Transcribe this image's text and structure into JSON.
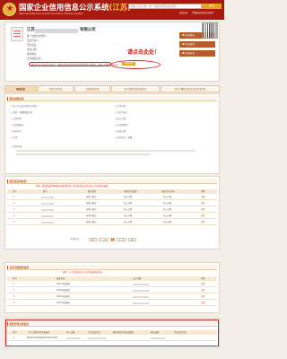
{
  "header": {
    "title_main": "国家企业信用信息公示系统",
    "title_region": "(江苏)",
    "subtitle": "National Enterprise Credit Information Publicity System",
    "search_placeholder": "请输入企业名称、统一社会信用代码或注册号",
    "search_button": "搜 索",
    "links": [
      "信息公告",
      "严重违法失信企业名单"
    ]
  },
  "company": {
    "name_prefix": "江苏",
    "name_suffix": "有限公司",
    "status_badge": "存续",
    "info_lines": [
      "统一社会信用代码：",
      "法定代表人：",
      "登记机关：",
      "成立日期：",
      "通讯地址：",
      "企业联系方式："
    ],
    "alert_text": "◆ 该企业于某年某月某日，因通过登记的住所或者经营场所无法联系，被列入经营异常名录",
    "detail_button": "查看详情",
    "callout": "请点击此处！",
    "side_buttons": [
      "发送报告",
      "信息打印",
      "信息补录"
    ]
  },
  "tabs": [
    "基础信息",
    "行政许可信息",
    "行政处罚信息",
    "列入经营异常名录信息",
    "列入严重违法失信企业名单信息"
  ],
  "basic_info": {
    "section_title": "营业执照信息",
    "fields_left": [
      {
        "k": "统一社会信用代码/注册号：",
        "v": ""
      },
      {
        "k": "类型：",
        "v": "有限责任公司"
      },
      {
        "k": "注册资本：",
        "v": ""
      },
      {
        "k": "营业期限自：",
        "v": ""
      },
      {
        "k": "登记机关：",
        "v": ""
      },
      {
        "k": "住所：",
        "v": ""
      }
    ],
    "fields_right": [
      {
        "k": "企业名称：",
        "v": ""
      },
      {
        "k": "法定代表人：",
        "v": ""
      },
      {
        "k": "成立日期：",
        "v": ""
      },
      {
        "k": "营业期限至：",
        "v": ""
      },
      {
        "k": "核准日期：",
        "v": ""
      },
      {
        "k": "登记状态：",
        "v": "存续"
      }
    ],
    "scope_label": "经营范围："
  },
  "shareholders": {
    "section_title": "股东及出资信息",
    "note": "说明：请企业及时更新股东及出资信息，登记机关依法对企业公示信息进行抽查。",
    "columns": [
      "序号",
      "股东",
      "股东类型",
      "证照/证件类型",
      "证照/证件号码",
      "详情"
    ],
    "rows": [
      {
        "no": "1",
        "type": "自然人股东",
        "id_type": "非公示项",
        "detail": "查看"
      },
      {
        "no": "2",
        "type": "自然人股东",
        "id_type": "非公示项",
        "detail": "查看"
      },
      {
        "no": "3",
        "type": "自然人股东",
        "id_type": "非公示项",
        "detail": "查看"
      },
      {
        "no": "4",
        "type": "自然人股东",
        "id_type": "非公示项",
        "detail": "查看"
      },
      {
        "no": "5",
        "type": "自然人股东",
        "id_type": "非公示项",
        "detail": "查看"
      }
    ],
    "pager": {
      "total": "共5条信息",
      "first": "首页",
      "prev": "上一页",
      "page": "1",
      "next": "下一页",
      "last": "末页"
    }
  },
  "annual_reports": {
    "section_title": "企业年度报告信息",
    "note": "说明：以下为企业自行公示的年度报告信息。",
    "columns": [
      "序号",
      "报送年度",
      "公示日期",
      "详情"
    ],
    "rows": [
      {
        "no": "1",
        "year": "2017年度报告",
        "date": "",
        "detail": "查看"
      },
      {
        "no": "2",
        "year": "2016年度报告",
        "date": "",
        "detail": "查看"
      },
      {
        "no": "3",
        "year": "2015年度报告",
        "date": "",
        "detail": "查看"
      },
      {
        "no": "4",
        "year": "2014年度报告",
        "date": "",
        "detail": "查看"
      }
    ]
  },
  "abnormal_list": {
    "section_title": "经营异常名录信息",
    "columns": [
      "序号",
      "列入经营异常名录原因",
      "列入日期",
      "作出决定机关",
      "移出经营异常名录原因",
      "移出日期",
      "作出决定机关"
    ],
    "row": {
      "no": "1",
      "reason": "通过登记的住所或者经营场所无法联系",
      "date_in": "",
      "authority": "",
      "remove_reason": "",
      "date_out": "",
      "authority2": ""
    }
  }
}
